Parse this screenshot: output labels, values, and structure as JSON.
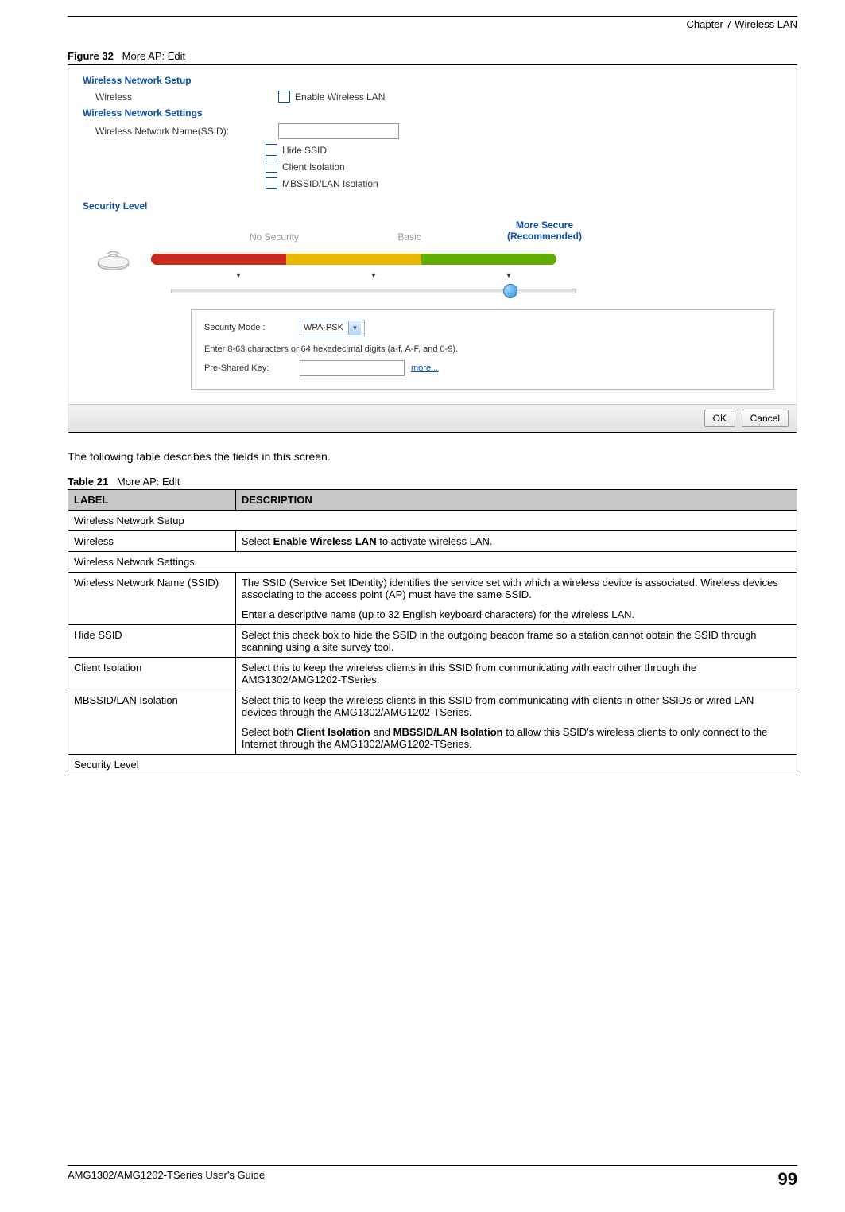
{
  "header": {
    "chapter": "Chapter 7 Wireless LAN"
  },
  "figure": {
    "label": "Figure 32",
    "title": "More AP: Edit",
    "section_setup": "Wireless Network Setup",
    "wireless_label": "Wireless",
    "enable_wlan": "Enable Wireless LAN",
    "section_settings": "Wireless Network Settings",
    "ssid_label": "Wireless Network Name(SSID):",
    "hide_ssid": "Hide SSID",
    "client_isolation": "Client Isolation",
    "mbssid_isolation": "MBSSID/LAN Isolation",
    "section_security": "Security Level",
    "level_none": "No Security",
    "level_basic": "Basic",
    "level_more1": "More Secure",
    "level_more2": "(Recommended)",
    "sec_mode_label": "Security Mode :",
    "sec_mode_value": "WPA-PSK",
    "psk_hint": "Enter 8-63 characters or 64 hexadecimal digits (a-f, A-F, and 0-9).",
    "psk_label": "Pre-Shared Key:",
    "more_link": "more...",
    "ok": "OK",
    "cancel": "Cancel"
  },
  "intro": "The following table describes the fields in this screen.",
  "table": {
    "label": "Table 21",
    "title": "More AP: Edit",
    "h_label": "LABEL",
    "h_desc": "DESCRIPTION",
    "rows": [
      {
        "span": true,
        "label": "Wireless Network Setup"
      },
      {
        "label": "Wireless",
        "desc": "Select <b>Enable Wireless LAN</b> to activate wireless LAN."
      },
      {
        "span": true,
        "label": "Wireless Network Settings"
      },
      {
        "label": "Wireless Network Name (SSID)",
        "desc": "<p>The SSID (Service Set IDentity) identifies the service set with which a wireless device is associated. Wireless devices associating to the access point (AP) must have the same SSID.</p><p>Enter a descriptive name (up to 32 English keyboard characters) for the wireless LAN.</p>"
      },
      {
        "label": "Hide SSID",
        "desc": "Select this check box to hide the SSID in the outgoing beacon frame so a station cannot obtain the SSID through scanning using a site survey tool."
      },
      {
        "label": "Client Isolation",
        "desc": "Select this to keep the wireless clients in this SSID from communicating with each other through the AMG1302/AMG1202-TSeries."
      },
      {
        "label": "MBSSID/LAN Isolation",
        "desc": "<p>Select this to keep the wireless clients in this SSID from communicating with clients in other SSIDs or wired LAN devices through the AMG1302/AMG1202-TSeries.</p><p>Select both <b>Client Isolation</b> and <b>MBSSID/LAN Isolation</b> to allow this SSID's wireless clients to only connect to the Internet through the AMG1302/AMG1202-TSeries.</p>"
      },
      {
        "span": true,
        "label": "Security Level"
      }
    ]
  },
  "footer": {
    "guide": "AMG1302/AMG1202-TSeries User's Guide",
    "page": "99"
  }
}
